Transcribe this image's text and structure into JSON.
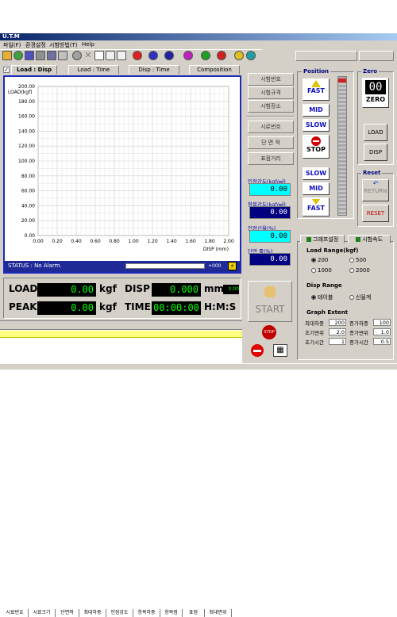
{
  "app": {
    "title": "U.T.M"
  },
  "menu": [
    "파일(F)",
    "환경설정",
    "시험방법(T)",
    "Help"
  ],
  "tabs": [
    "Load : Disp",
    "Load : Time",
    "Disp : Time",
    "Composition"
  ],
  "chart_data": {
    "type": "line",
    "title": "",
    "xlabel": "DISP (mm)",
    "ylabel": "LOAD(kgf)",
    "xlim": [
      0,
      2.0
    ],
    "ylim": [
      0,
      200
    ],
    "x_ticks": [
      "0.00",
      "0.20",
      "0.40",
      "0.60",
      "0.80",
      "1.00",
      "1.20",
      "1.40",
      "1.60",
      "1.80",
      "2.00"
    ],
    "y_ticks": [
      "0.00",
      "20.00",
      "40.00",
      "60.00",
      "80.00",
      "100.00",
      "120.00",
      "140.00",
      "160.00",
      "180.00",
      "200.00"
    ],
    "grid": true,
    "series": []
  },
  "status": {
    "text": "STATUS : No Alarm.",
    "progress_value": "+000"
  },
  "side_buttons": [
    "시험번호",
    "시험규격",
    "시험장소",
    "시료번호",
    "단 면 적",
    "표점거리"
  ],
  "side_readouts": [
    {
      "label": "인장강도(kgf/㎟)",
      "value": "0.00"
    },
    {
      "label": "항복강도(kgf/㎟)",
      "value": "0.00"
    },
    {
      "label": "인장신율(%)",
      "value": "0.00"
    },
    {
      "label": "단면 률(%)",
      "value": "0.00"
    }
  ],
  "monitor": {
    "load_label": "LOAD",
    "load_value": "0.00",
    "load_unit": "kgf",
    "disp_label": "DISP",
    "disp_value": "0.000",
    "disp_unit": "mm",
    "disp_small": "0.00",
    "peak_label": "PEAK",
    "peak_value": "0.00",
    "peak_unit": "kgf",
    "time_label": "TIME",
    "time_value": "00:00:00",
    "time_unit": "H:M:S"
  },
  "results_columns": [
    "시료번호",
    "시료크기",
    "단면적",
    "최대하중",
    "인장강도",
    "항복하중",
    "항복점",
    "표점",
    "최대변위"
  ],
  "start_label": "START",
  "stop_label": "STOP",
  "position": {
    "title": "Position",
    "up": [
      "FAST",
      "MID",
      "SLOW"
    ],
    "stop": "STOP",
    "down": [
      "SLOW",
      "MID",
      "FAST"
    ]
  },
  "zero": {
    "title": "Zero",
    "display": "00",
    "button": "ZERO",
    "load_btn": "LOAD",
    "disp_btn": "DISP"
  },
  "reset": {
    "title": "Reset",
    "return_btn": "RETURN",
    "reset_btn": "RESET"
  },
  "settings_tabs": [
    "그래프설정",
    "시험속도"
  ],
  "load_range": {
    "title": "Load Range(kgf)",
    "options": [
      "200",
      "500",
      "1000",
      "2000"
    ],
    "selected": "200"
  },
  "disp_range": {
    "title": "Disp Range",
    "options": [
      "테이블",
      "신율계"
    ],
    "selected": "테이블"
  },
  "graph_extent": {
    "title": "Graph Extent",
    "rows": [
      {
        "l1": "최대하중",
        "v1": "200",
        "l2": "증가하중",
        "v2": "100"
      },
      {
        "l1": "초기변위",
        "v1": "2.0",
        "l2": "증가변위",
        "v2": "1.0"
      },
      {
        "l1": "초기시간",
        "v1": "1",
        "l2": "증가시간",
        "v2": "0.5"
      }
    ]
  }
}
